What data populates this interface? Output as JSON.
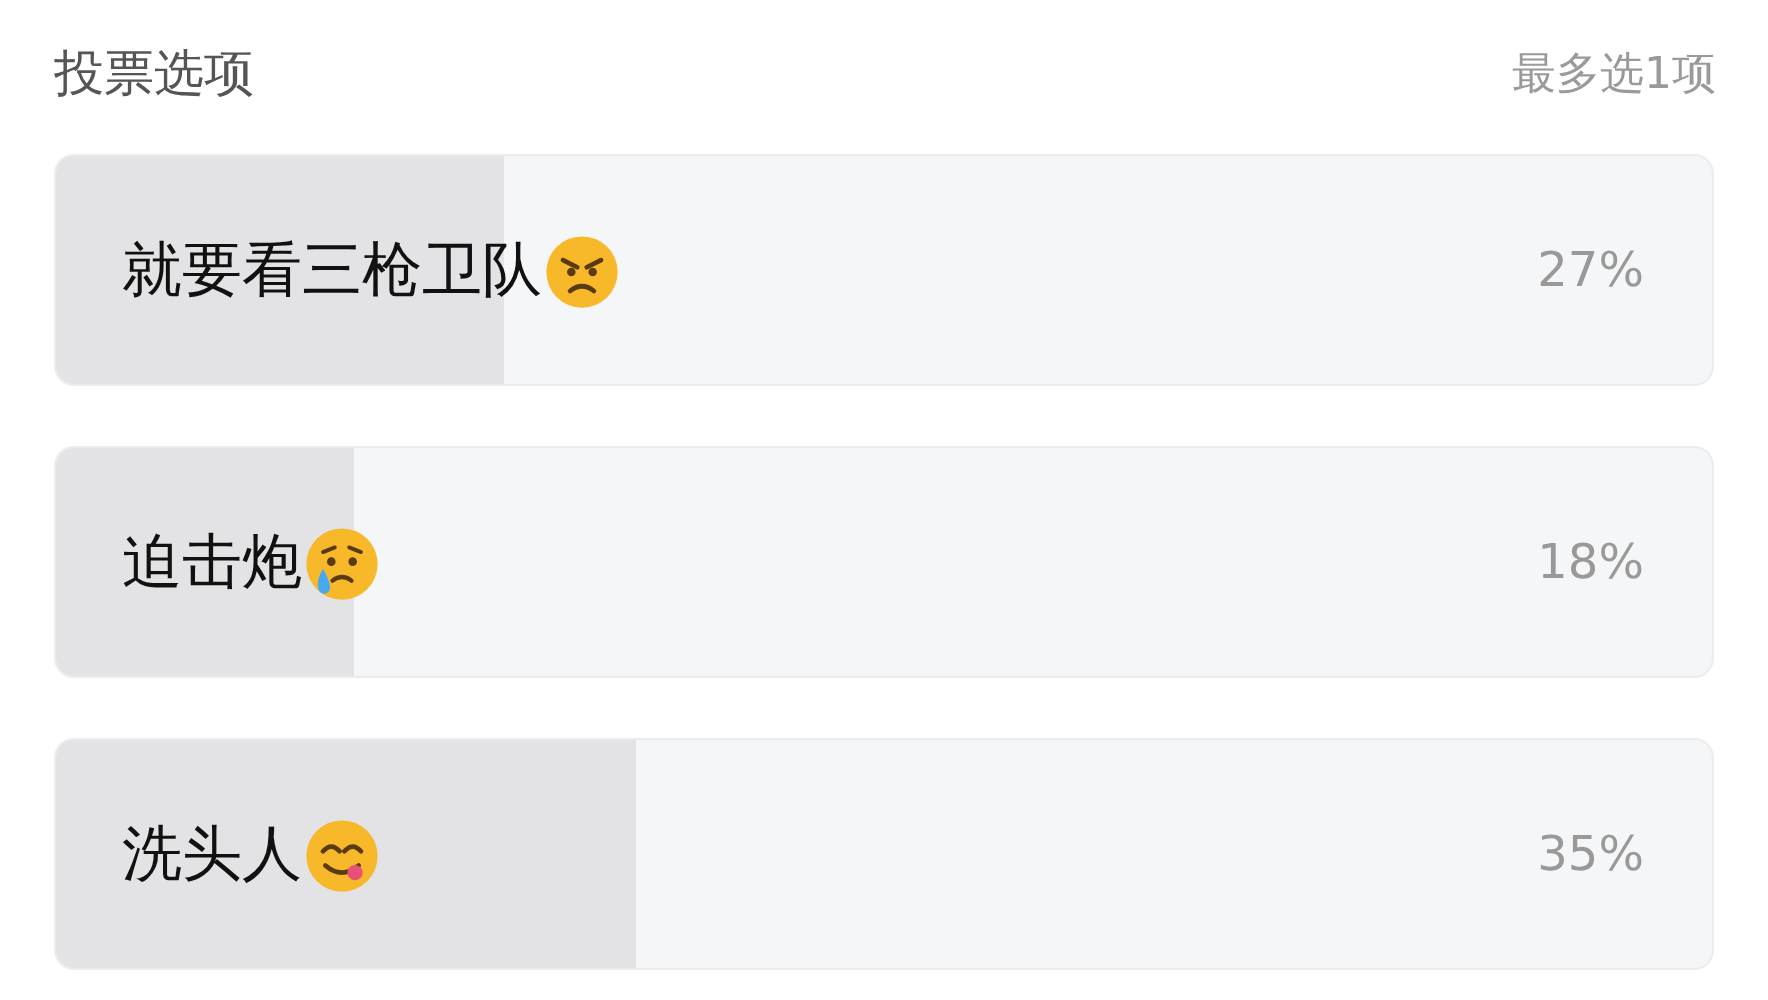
{
  "header": {
    "title": "投票选项",
    "limit": "最多选1项"
  },
  "options": [
    {
      "label": "就要看三枪卫队",
      "kind": "angry",
      "level": 0.27,
      "percent": "27%"
    },
    {
      "label": "迫击炮",
      "kind": "crying",
      "level": 0.18,
      "percent": "18%"
    },
    {
      "label": "洗头人",
      "kind": "yum",
      "level": 0.35,
      "percent": "35%"
    }
  ]
}
